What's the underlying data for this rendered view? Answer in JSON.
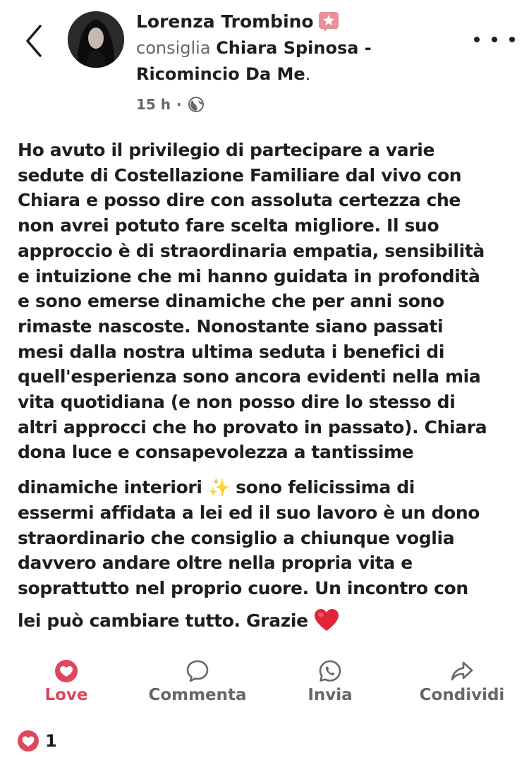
{
  "header": {
    "author": "Lorenza Trombino",
    "recommends_verb": "consiglia",
    "page_name_line1": "Chiara Spinosa -",
    "page_name_line2": "Ricomincio Da Me",
    "page_name_suffix": ".",
    "timestamp": "15 h",
    "separator": "·"
  },
  "post": {
    "text_part1": "Ho avuto il privilegio di partecipare a varie\nsedute di Costellazione Familiare dal vivo con\nChiara e posso dire con assoluta certezza che\nnon avrei potuto fare scelta migliore. Il suo\napproccio è di straordinaria empatia, sensibilità\ne intuizione che mi hanno guidata in profondità\ne sono emerse dinamiche che per anni sono\nrimaste nascoste. Nonostante siano passati\nmesi dalla nostra ultima seduta i benefici di\nquell'esperienza sono ancora evidenti nella mia\nvita quotidiana (e non posso dire lo stesso di\naltri approcci che ho provato in passato). Chiara\ndona luce e consapevolezza a tantissime",
    "text_part2": "dinamiche interiori",
    "emoji_sparkles": "✨",
    "text_part3": " sono felicissima di\nessermi affidata a lei ed il suo lavoro è un dono\nstraordinario che consiglio a chiunque voglia\ndavvero andare oltre nella propria vita e\nsoprattutto nel proprio cuore. Un incontro con",
    "text_part4": "lei può cambiare tutto. Grazie "
  },
  "actions": {
    "love": "Love",
    "comment": "Commenta",
    "send": "Invia",
    "share": "Condividi"
  },
  "reactions": {
    "count": "1"
  },
  "colors": {
    "love": "#e0465e",
    "muted": "#65676b",
    "text": "#1c1e21"
  },
  "icons": {
    "back": "chevron-left-icon",
    "badge": "star-badge-icon",
    "privacy": "globe-icon",
    "more": "more-dots-icon",
    "love": "heart-icon",
    "comment": "comment-bubble-icon",
    "send": "whatsapp-icon",
    "share": "share-arrow-icon"
  }
}
